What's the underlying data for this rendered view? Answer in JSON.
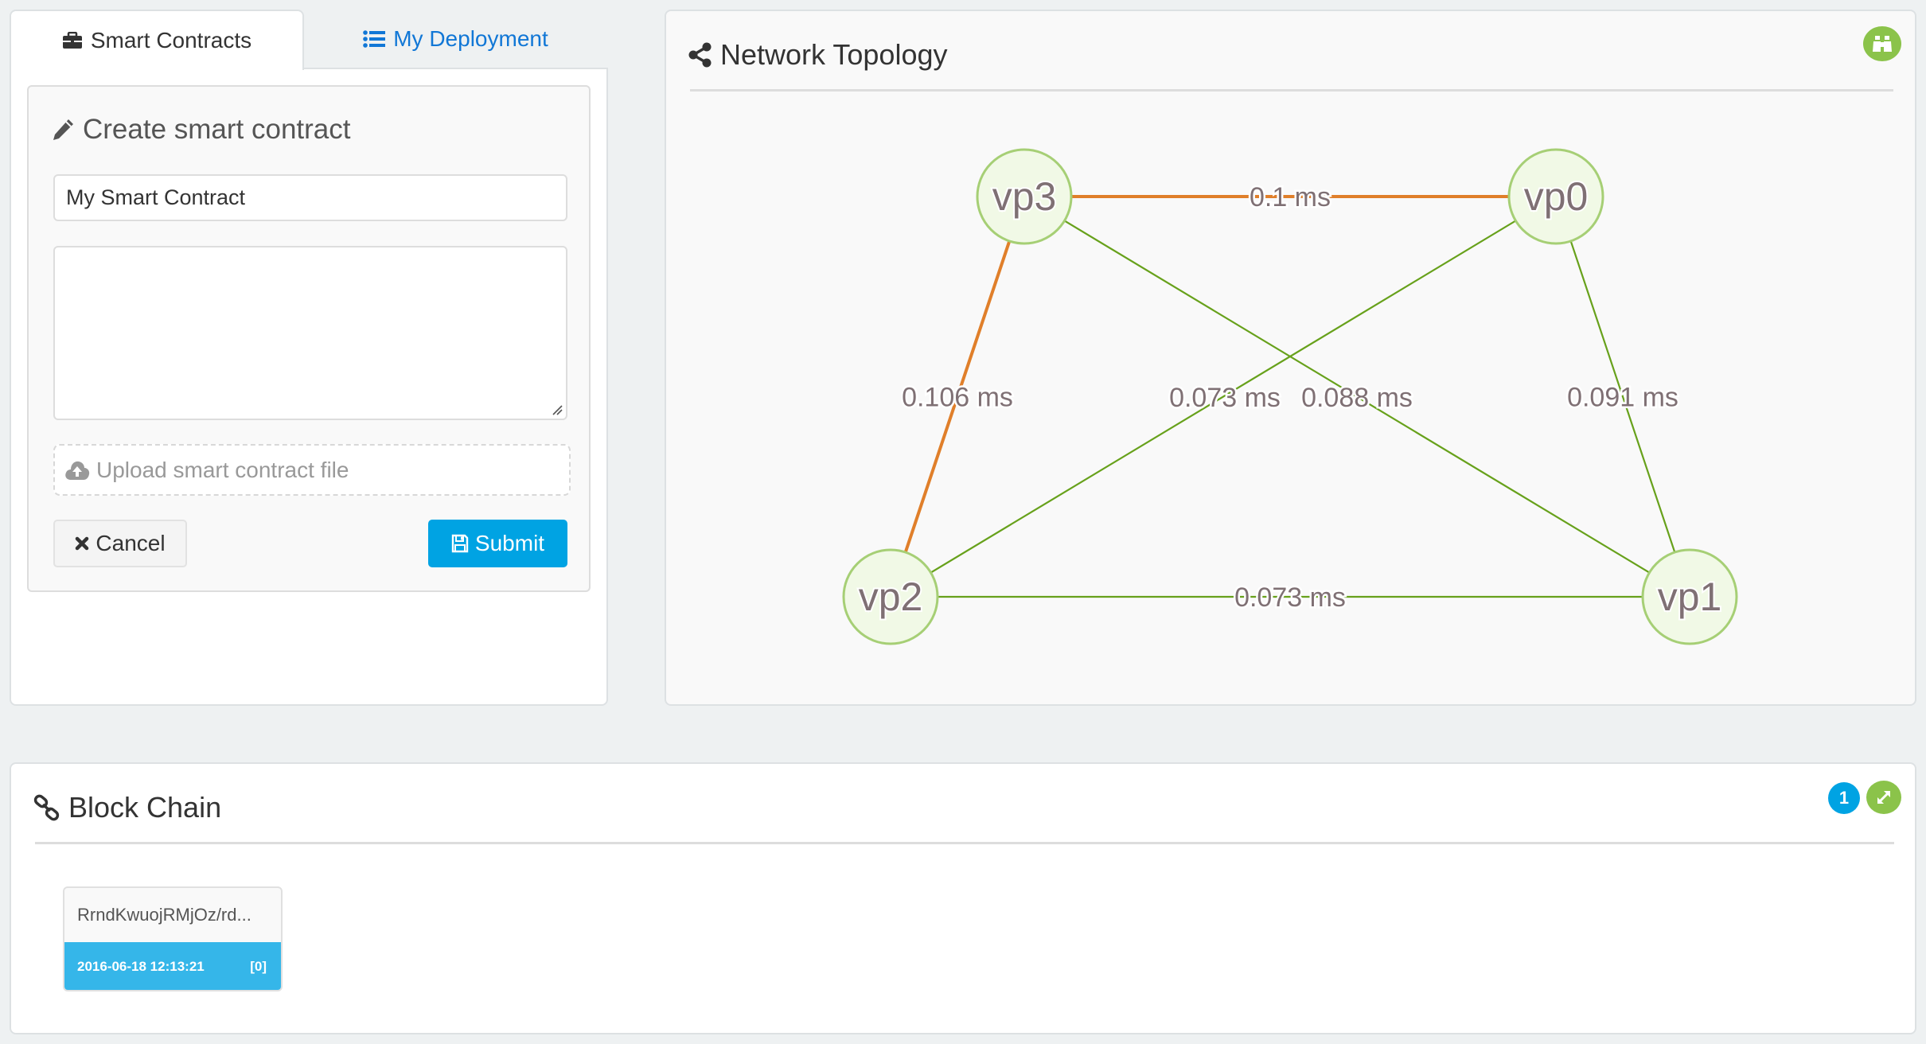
{
  "tabs": [
    {
      "label": "Smart Contracts",
      "icon": "briefcase-icon",
      "active": true
    },
    {
      "label": "My Deployment",
      "icon": "list-icon",
      "active": false
    }
  ],
  "create_card": {
    "title": "Create smart contract",
    "name_input_value": "My Smart Contract",
    "code_textarea_value": "",
    "upload_label": "Upload smart contract file",
    "cancel_label": "Cancel",
    "submit_label": "Submit"
  },
  "topology": {
    "title": "Network Topology",
    "colors": {
      "node_fill": "#f1f9e6",
      "node_stroke": "#a6cf75",
      "slow_edge": "#e07f2a",
      "fast_edge": "#67a11b",
      "label": "#7f7074"
    },
    "nodes": [
      {
        "id": "vp3",
        "label": "vp3"
      },
      {
        "id": "vp0",
        "label": "vp0"
      },
      {
        "id": "vp2",
        "label": "vp2"
      },
      {
        "id": "vp1",
        "label": "vp1"
      }
    ],
    "edges": [
      {
        "source": "vp3",
        "target": "vp0",
        "label": "0.1 ms",
        "latency_ms": 0.1,
        "slow": true
      },
      {
        "source": "vp3",
        "target": "vp2",
        "label": "0.106 ms",
        "latency_ms": 0.106,
        "slow": true
      },
      {
        "source": "vp0",
        "target": "vp2",
        "label": "0.073 ms",
        "latency_ms": 0.073,
        "slow": false
      },
      {
        "source": "vp3",
        "target": "vp1",
        "label": "0.088 ms",
        "latency_ms": 0.088,
        "slow": false
      },
      {
        "source": "vp0",
        "target": "vp1",
        "label": "0.091 ms",
        "latency_ms": 0.091,
        "slow": false
      },
      {
        "source": "vp2",
        "target": "vp1",
        "label": "0.073 ms",
        "latency_ms": 0.073,
        "slow": false
      }
    ]
  },
  "blockchain": {
    "title": "Block Chain",
    "count_badge": "1",
    "blocks": [
      {
        "hash": "RrndKwuojRMjOz/rd...",
        "timestamp": "2016-06-18 12:13:21",
        "index": "[0]"
      }
    ]
  }
}
